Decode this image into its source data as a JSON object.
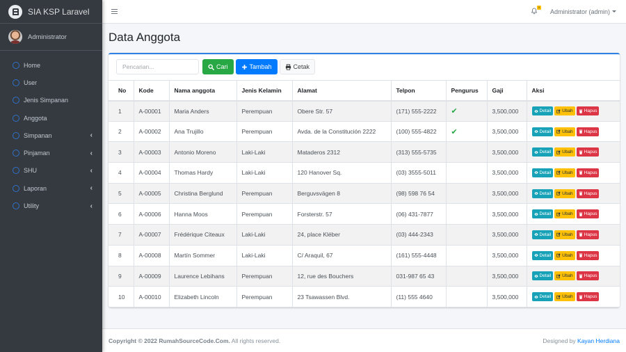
{
  "app": {
    "title": "SIA KSP Laravel"
  },
  "user": {
    "name": "Administrator"
  },
  "sidebar": {
    "items": [
      {
        "label": "Home",
        "has_submenu": false
      },
      {
        "label": "User",
        "has_submenu": false
      },
      {
        "label": "Jenis Simpanan",
        "has_submenu": false
      },
      {
        "label": "Anggota",
        "has_submenu": false
      },
      {
        "label": "Simpanan",
        "has_submenu": true
      },
      {
        "label": "Pinjaman",
        "has_submenu": true
      },
      {
        "label": "SHU",
        "has_submenu": true
      },
      {
        "label": "Laporan",
        "has_submenu": true
      },
      {
        "label": "Utility",
        "has_submenu": true
      }
    ]
  },
  "topbar": {
    "notification_count": "0",
    "account_label": "Administrator (admin)"
  },
  "page": {
    "title": "Data Anggota"
  },
  "toolbar": {
    "search_placeholder": "Pencarian...",
    "search_value": "",
    "cari_label": "Cari",
    "tambah_label": "Tambah",
    "cetak_label": "Cetak"
  },
  "table": {
    "headers": [
      "No",
      "Kode",
      "Nama anggota",
      "Jenis Kelamin",
      "Alamat",
      "Telpon",
      "Pengurus",
      "Gaji",
      "Aksi"
    ],
    "action_labels": {
      "detail": "Detail",
      "ubah": "Ubah",
      "hapus": "Hapus"
    },
    "rows": [
      {
        "no": "1",
        "kode": "A-00001",
        "nama": "Maria Anders",
        "jk": "Perempuan",
        "alamat": "Obere Str. 57",
        "telpon": "(171) 555-2222",
        "pengurus": true,
        "gaji": "3,500,000"
      },
      {
        "no": "2",
        "kode": "A-00002",
        "nama": "Ana Trujillo",
        "jk": "Perempuan",
        "alamat": "Avda. de la Constitución 2222",
        "telpon": "(100) 555-4822",
        "pengurus": true,
        "gaji": "3,500,000"
      },
      {
        "no": "3",
        "kode": "A-00003",
        "nama": "Antonio Moreno",
        "jk": "Laki-Laki",
        "alamat": "Mataderos 2312",
        "telpon": "(313) 555-5735",
        "pengurus": false,
        "gaji": "3,500,000"
      },
      {
        "no": "4",
        "kode": "A-00004",
        "nama": "Thomas Hardy",
        "jk": "Laki-Laki",
        "alamat": "120 Hanover Sq.",
        "telpon": "(03) 3555-5011",
        "pengurus": false,
        "gaji": "3,500,000"
      },
      {
        "no": "5",
        "kode": "A-00005",
        "nama": "Christina Berglund",
        "jk": "Perempuan",
        "alamat": "Berguvsvägen 8",
        "telpon": "(98) 598 76 54",
        "pengurus": false,
        "gaji": "3,500,000"
      },
      {
        "no": "6",
        "kode": "A-00006",
        "nama": "Hanna Moos",
        "jk": "Perempuan",
        "alamat": "Forsterstr. 57",
        "telpon": "(06) 431-7877",
        "pengurus": false,
        "gaji": "3,500,000"
      },
      {
        "no": "7",
        "kode": "A-00007",
        "nama": "Frédérique Citeaux",
        "jk": "Laki-Laki",
        "alamat": "24, place Kléber",
        "telpon": "(03) 444-2343",
        "pengurus": false,
        "gaji": "3,500,000"
      },
      {
        "no": "8",
        "kode": "A-00008",
        "nama": "Martín Sommer",
        "jk": "Laki-Laki",
        "alamat": "C/ Araquil, 67",
        "telpon": "(161) 555-4448",
        "pengurus": false,
        "gaji": "3,500,000"
      },
      {
        "no": "9",
        "kode": "A-00009",
        "nama": "Laurence Lebihans",
        "jk": "Perempuan",
        "alamat": "12, rue des Bouchers",
        "telpon": "031-987 65 43",
        "pengurus": false,
        "gaji": "3,500,000"
      },
      {
        "no": "10",
        "kode": "A-00010",
        "nama": "Elizabeth Lincoln",
        "jk": "Perempuan",
        "alamat": "23 Tsawassen Blvd.",
        "telpon": "(11) 555 4640",
        "pengurus": false,
        "gaji": "3,500,000"
      }
    ]
  },
  "footer": {
    "copyright": "Copyright © 2022 RumahSourceCode.Com.",
    "rights": " All rights reserved.",
    "designed_by": "Designed by ",
    "designer": "Kayan Herdiana"
  },
  "colors": {
    "sidebar_bg": "#343a40",
    "accent_blue": "#007bff",
    "success": "#28a745",
    "info": "#17a2b8",
    "warning": "#ffc107",
    "danger": "#dc3545"
  }
}
